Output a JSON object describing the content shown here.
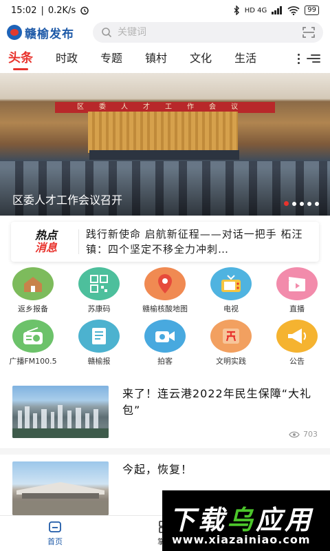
{
  "status_bar": {
    "time": "15:02",
    "speed": "0.2K/s",
    "signal": "HD 4G",
    "battery": "99"
  },
  "header": {
    "app_name": "赣榆发布",
    "search_placeholder": "关键词"
  },
  "tabs": [
    {
      "label": "头条",
      "active": true
    },
    {
      "label": "时政",
      "active": false
    },
    {
      "label": "专题",
      "active": false
    },
    {
      "label": "镇村",
      "active": false
    },
    {
      "label": "文化",
      "active": false
    },
    {
      "label": "生活",
      "active": false
    }
  ],
  "banner": {
    "caption": "区委人才工作会议召开",
    "stage_banner": "区委人才工作会议",
    "slide_count": 5,
    "active_slide": 1
  },
  "hot_news": {
    "tag_line1": "热点",
    "tag_line2": "消息",
    "text": "践行新使命 启航新征程——对话一把手 柘汪镇：四个坚定不移全力冲刺…"
  },
  "services": [
    {
      "label": "返乡报备",
      "icon": "house-icon",
      "color": "#7dbb5c"
    },
    {
      "label": "苏康码",
      "icon": "qr-code-icon",
      "color": "#4dbf9c"
    },
    {
      "label": "赣榆核酸地图",
      "icon": "map-pin-icon",
      "color": "#f08a52"
    },
    {
      "label": "电视",
      "icon": "tv-icon",
      "color": "#4fb3e0"
    },
    {
      "label": "直播",
      "icon": "clapper-icon",
      "color": "#f28bab"
    },
    {
      "label": "广播FM100.5",
      "icon": "radio-icon",
      "color": "#6cc26a"
    },
    {
      "label": "赣榆报",
      "icon": "newspaper-icon",
      "color": "#4cb2cf"
    },
    {
      "label": "拍客",
      "icon": "camera-icon",
      "color": "#48a9df"
    },
    {
      "label": "文明实践",
      "icon": "flag-icon",
      "color": "#f2a060"
    },
    {
      "label": "公告",
      "icon": "megaphone-icon",
      "color": "#f5b330"
    }
  ],
  "news": [
    {
      "title": "来了！连云港2022年民生保障“大礼包”",
      "views": "703"
    },
    {
      "title": "今起，恢复！",
      "views": ""
    }
  ],
  "bottom_nav": [
    {
      "label": "首页",
      "icon": "home-icon",
      "active": true
    },
    {
      "label": "掌上",
      "icon": "grid-icon",
      "active": false
    },
    {
      "label": "",
      "icon": "user-icon",
      "active": false
    }
  ],
  "watermark": {
    "line1_a": "下载",
    "line1_b": "乌",
    "line1_c": "应用",
    "line2": "www.xiazainiao.com"
  }
}
